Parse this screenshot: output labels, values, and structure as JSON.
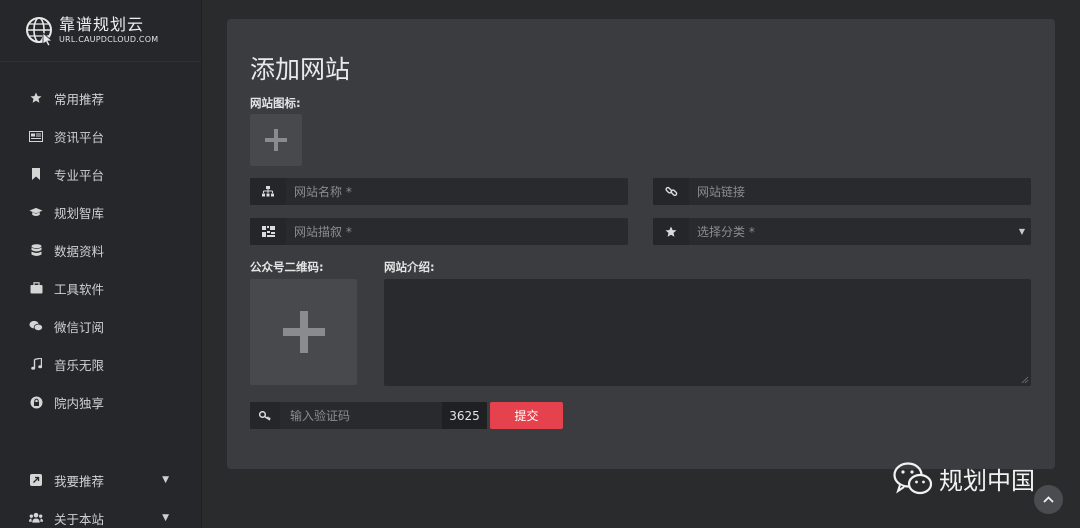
{
  "brand": {
    "name": "靠谱规划云",
    "url": "URL.CAUPDCLOUD.COM"
  },
  "sidebar": {
    "items": [
      {
        "label": "常用推荐",
        "icon": "star-icon"
      },
      {
        "label": "资讯平台",
        "icon": "newspaper-icon"
      },
      {
        "label": "专业平台",
        "icon": "bookmark-icon"
      },
      {
        "label": "规划智库",
        "icon": "graduation-cap-icon"
      },
      {
        "label": "数据资料",
        "icon": "database-icon"
      },
      {
        "label": "工具软件",
        "icon": "briefcase-icon"
      },
      {
        "label": "微信订阅",
        "icon": "wechat-icon"
      },
      {
        "label": "音乐无限",
        "icon": "music-icon"
      },
      {
        "label": "院内独享",
        "icon": "lock-circle-icon"
      }
    ],
    "bottom": [
      {
        "label": "我要推荐",
        "icon": "external-link-icon",
        "caret": "▼"
      },
      {
        "label": "关于本站",
        "icon": "users-icon",
        "caret": "▼"
      }
    ]
  },
  "form": {
    "title": "添加网站",
    "icon_label": "网站图标:",
    "name_placeholder": "网站名称 *",
    "link_placeholder": "网站链接",
    "desc_placeholder": "网站描叙 *",
    "category_placeholder": "选择分类 *",
    "qr_label": "公众号二维码:",
    "intro_label": "网站介绍:",
    "captcha_placeholder": "输入验证码",
    "captcha_code": "3625",
    "submit_label": "提交"
  },
  "watermark": {
    "text": "规划中国"
  },
  "colors": {
    "accent": "#e6424e",
    "card": "#3a3c40",
    "sidebar": "#26272a"
  }
}
